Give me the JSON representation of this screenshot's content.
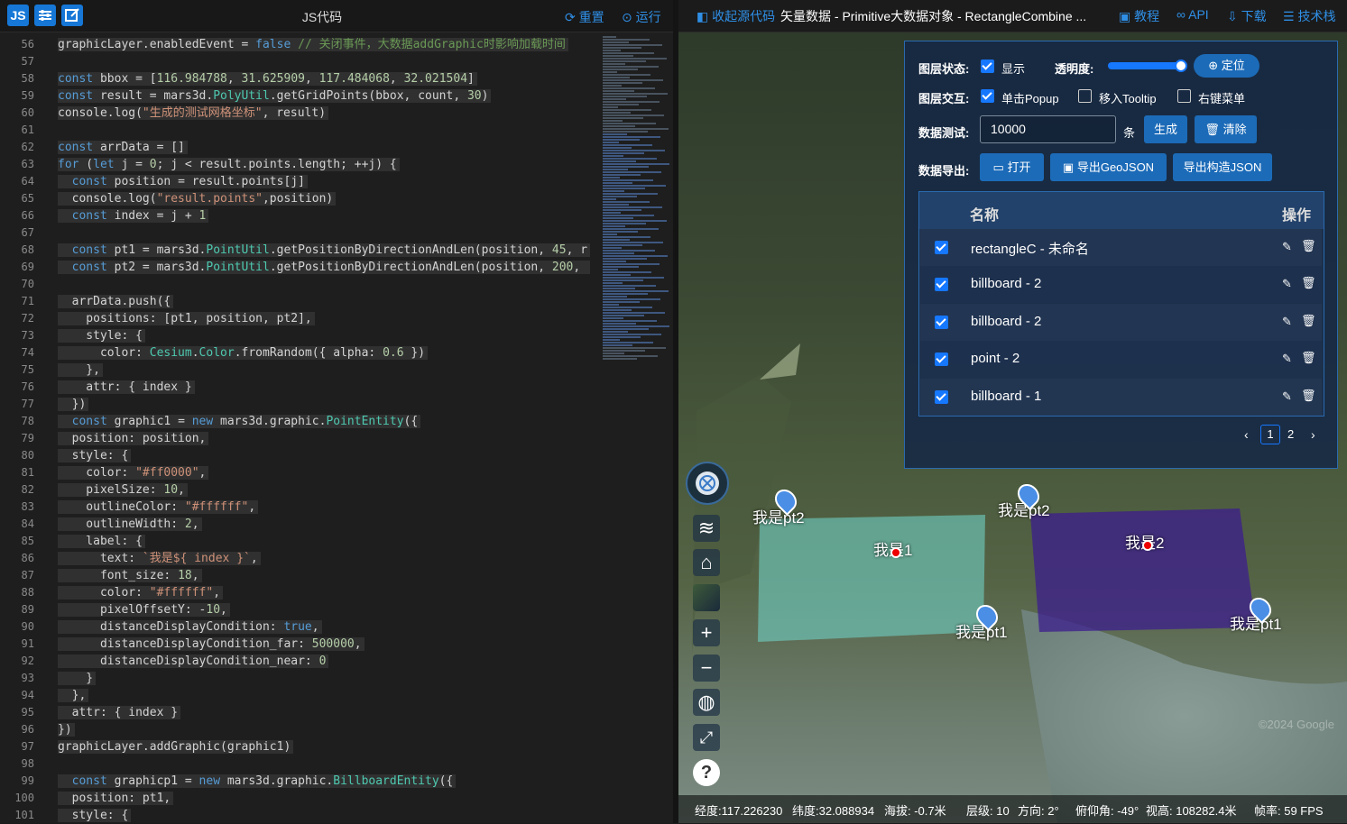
{
  "left_toolbar": {
    "js_icon": "JS",
    "title": "JS代码",
    "reset": "重置",
    "run": "运行"
  },
  "code_lines": [
    {
      "n": "56",
      "t": "graphicLayer.enabledEvent = false // 关闭事件，大数据addGraphic时影响加载时间"
    },
    {
      "n": "57",
      "t": ""
    },
    {
      "n": "58",
      "t": "const bbox = [116.984788, 31.625909, 117.484068, 32.021504]"
    },
    {
      "n": "59",
      "t": "const result = mars3d.PolyUtil.getGridPoints(bbox, count, 30)"
    },
    {
      "n": "60",
      "t": "console.log(\"生成的测试网格坐标\", result)"
    },
    {
      "n": "61",
      "t": ""
    },
    {
      "n": "62",
      "t": "const arrData = []"
    },
    {
      "n": "63",
      "t": "for (let j = 0; j < result.points.length; ++j) {"
    },
    {
      "n": "64",
      "t": "  const position = result.points[j]"
    },
    {
      "n": "65",
      "t": "  console.log(\"result.points\",position)"
    },
    {
      "n": "66",
      "t": "  const index = j + 1"
    },
    {
      "n": "67",
      "t": ""
    },
    {
      "n": "68",
      "t": "  const pt1 = mars3d.PointUtil.getPositionByDirectionAndLen(position, 45, r"
    },
    {
      "n": "69",
      "t": "  const pt2 = mars3d.PointUtil.getPositionByDirectionAndLen(position, 200, "
    },
    {
      "n": "70",
      "t": ""
    },
    {
      "n": "71",
      "t": "  arrData.push({"
    },
    {
      "n": "72",
      "t": "    positions: [pt1, position, pt2],"
    },
    {
      "n": "73",
      "t": "    style: {"
    },
    {
      "n": "74",
      "t": "      color: Cesium.Color.fromRandom({ alpha: 0.6 })"
    },
    {
      "n": "75",
      "t": "    },"
    },
    {
      "n": "76",
      "t": "    attr: { index }"
    },
    {
      "n": "77",
      "t": "  })"
    },
    {
      "n": "78",
      "t": "  const graphic1 = new mars3d.graphic.PointEntity({"
    },
    {
      "n": "79",
      "t": "  position: position,"
    },
    {
      "n": "80",
      "t": "  style: {"
    },
    {
      "n": "81",
      "t": "    color: \"#ff0000\","
    },
    {
      "n": "82",
      "t": "    pixelSize: 10,"
    },
    {
      "n": "83",
      "t": "    outlineColor: \"#ffffff\","
    },
    {
      "n": "84",
      "t": "    outlineWidth: 2,"
    },
    {
      "n": "85",
      "t": "    label: {"
    },
    {
      "n": "86",
      "t": "      text: `我是${ index }`,"
    },
    {
      "n": "87",
      "t": "      font_size: 18,"
    },
    {
      "n": "88",
      "t": "      color: \"#ffffff\","
    },
    {
      "n": "89",
      "t": "      pixelOffsetY: -10,"
    },
    {
      "n": "90",
      "t": "      distanceDisplayCondition: true,"
    },
    {
      "n": "91",
      "t": "      distanceDisplayCondition_far: 500000,"
    },
    {
      "n": "92",
      "t": "      distanceDisplayCondition_near: 0"
    },
    {
      "n": "93",
      "t": "    }"
    },
    {
      "n": "94",
      "t": "  },"
    },
    {
      "n": "95",
      "t": "  attr: { index }"
    },
    {
      "n": "96",
      "t": "})"
    },
    {
      "n": "97",
      "t": "graphicLayer.addGraphic(graphic1)"
    },
    {
      "n": "98",
      "t": ""
    },
    {
      "n": "99",
      "t": "  const graphicp1 = new mars3d.graphic.BillboardEntity({"
    },
    {
      "n": "100",
      "t": "  position: pt1,"
    },
    {
      "n": "101",
      "t": "  style: {"
    }
  ],
  "right_toolbar": {
    "collapse": "收起源代码",
    "title": "矢量数据 - Primitive大数据对象 - RectangleCombine ...",
    "tutorial": "教程",
    "api": "API",
    "download": "下载",
    "support": "技术栈"
  },
  "panel": {
    "layer_state_label": "图层状态:",
    "show_label": "显示",
    "opacity_label": "透明度:",
    "locate_button": "定位",
    "interaction_label": "图层交互:",
    "popup_label": "单击Popup",
    "tooltip_label": "移入Tooltip",
    "contextmenu_label": "右键菜单",
    "data_test_label": "数据测试:",
    "count_value": "10000",
    "count_unit": "条",
    "generate_button": "生成",
    "clear_button": "清除",
    "export_label": "数据导出:",
    "open_button": "打开",
    "export_geojson_button": "导出GeoJSON",
    "export_struct_button": "导出构造JSON",
    "table": {
      "col_name": "名称",
      "col_action": "操作",
      "rows": [
        {
          "name": "rectangleC - 未命名"
        },
        {
          "name": "billboard - 2"
        },
        {
          "name": "billboard - 2"
        },
        {
          "name": "point - 2"
        },
        {
          "name": "billboard - 1"
        }
      ]
    },
    "pagination": {
      "page1": "1",
      "page2": "2"
    }
  },
  "map_labels": {
    "l1": "我是pt2",
    "l2": "我是1",
    "l3": "我是pt2",
    "l4": "我是2",
    "l5": "我是pt1",
    "l6": "我是pt1"
  },
  "status_bar": {
    "lon": "经度:117.226230",
    "lat": "纬度:32.088934",
    "alt": "海拔: -0.7米",
    "level": "层级: 10",
    "heading": "方向: 2°",
    "pitch": "俯仰角: -49°",
    "view": "视高: 108282.4米",
    "fps": "帧率: 59 FPS"
  },
  "watermark": "©2024 Google",
  "colors": {
    "accent": "#1677ff",
    "button": "#1c6bb8",
    "link": "#2f8fe6"
  }
}
